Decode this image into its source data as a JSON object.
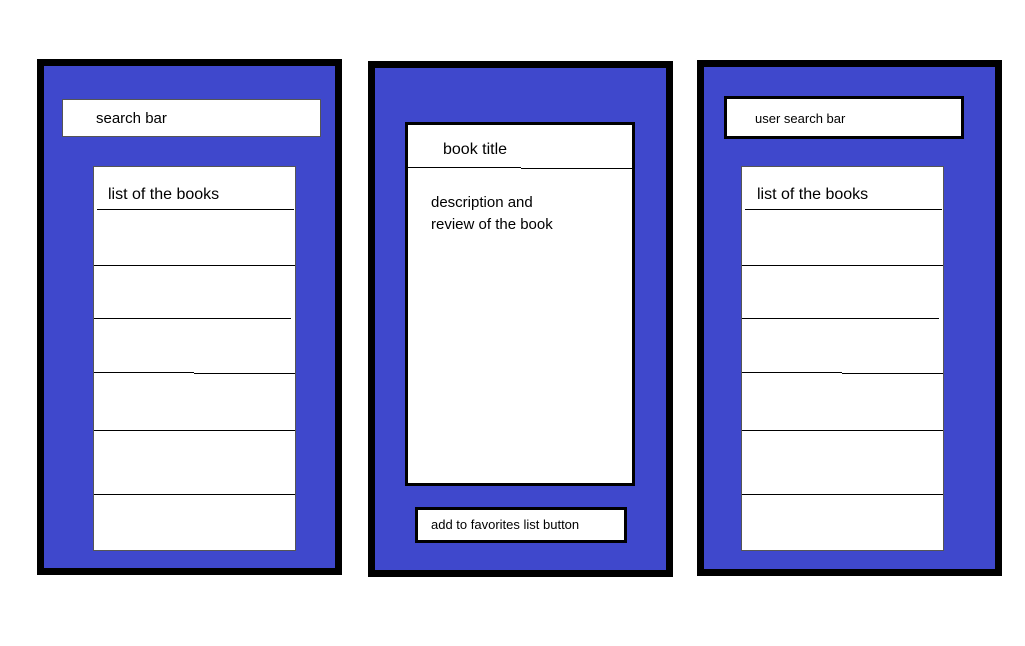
{
  "screens": {
    "search": {
      "search_bar_label": "search bar",
      "list_header": "list of the books",
      "list_rows": [
        "",
        "",
        "",
        "",
        "",
        ""
      ]
    },
    "detail": {
      "book_title": "book title",
      "description_line1": "description and",
      "description_line2": "review of the book",
      "favorites_button": "add to favorites list button"
    },
    "user": {
      "search_bar_label": "user search bar",
      "list_header": "list of the books",
      "list_rows": [
        "",
        "",
        "",
        "",
        "",
        ""
      ]
    }
  },
  "colors": {
    "screen_background": "#3f48cc",
    "frame": "#000000",
    "panel": "#ffffff"
  }
}
